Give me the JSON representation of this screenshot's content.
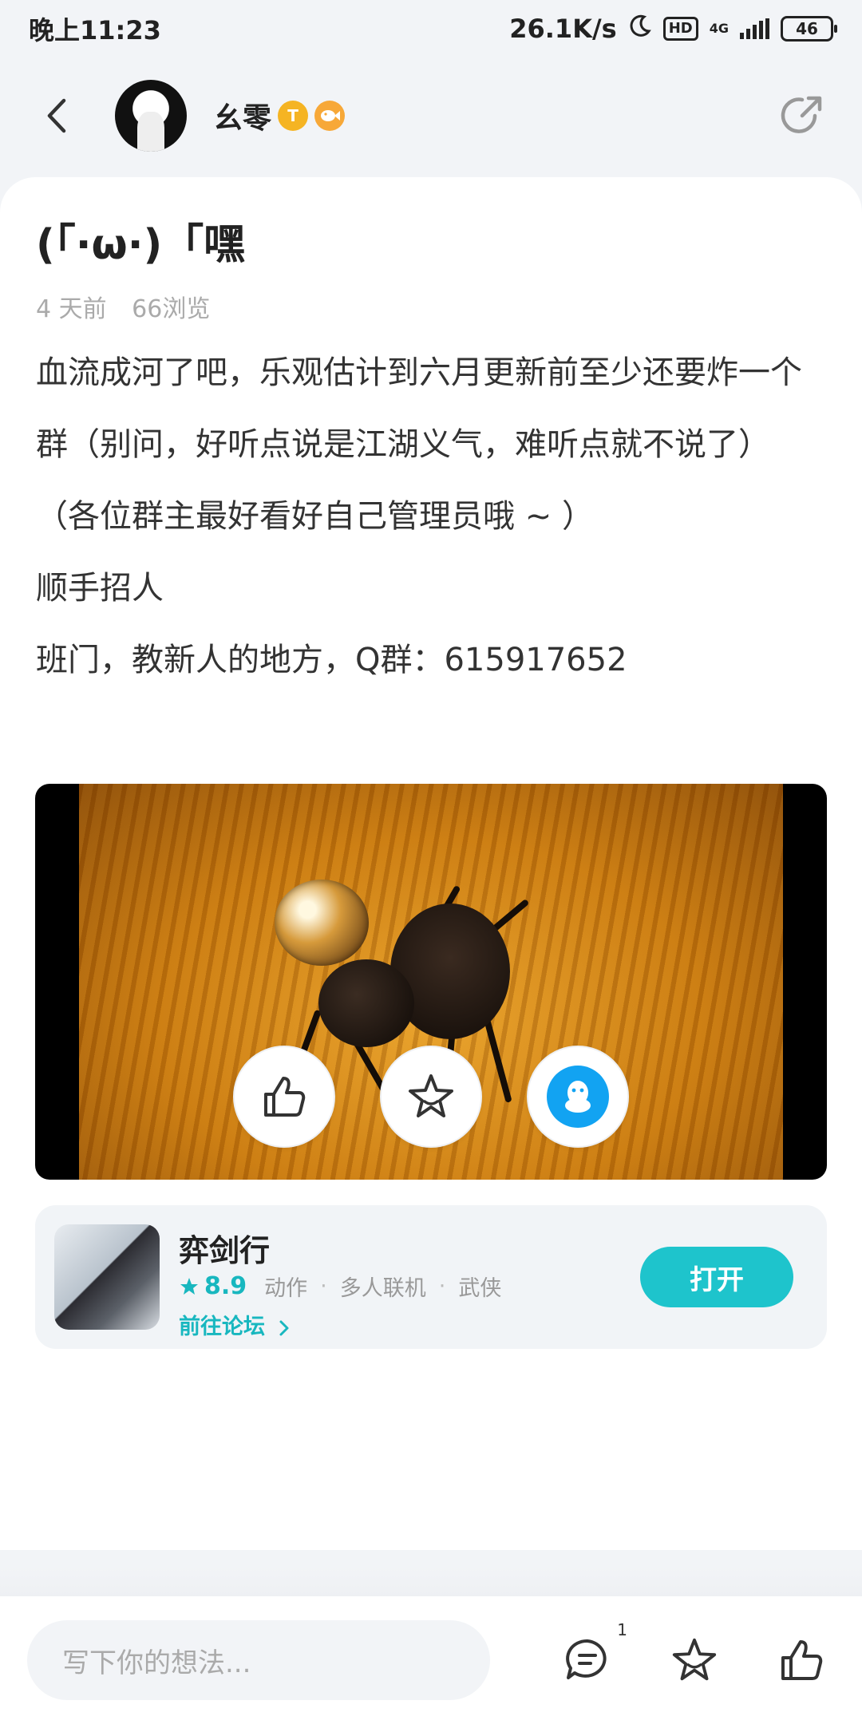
{
  "status_bar": {
    "time": "晚上11:23",
    "net_speed": "26.1K/s",
    "hd_label": "HD",
    "network_type": "4G",
    "battery": "46"
  },
  "header": {
    "author_name": "幺零",
    "badge_text": "T"
  },
  "post": {
    "title": "(「·ω·)「嘿",
    "time_ago": "4 天前",
    "views": "66浏览",
    "paragraphs": [
      "血流成河了吧，乐观估计到六月更新前至少还要炸一个群（别问，好听点说是江湖义气，难听点就不说了）",
      "（各位群主最好看好自己管理员哦 ~ ）",
      "顺手招人",
      "班门，教新人的地方，Q群：615917652"
    ]
  },
  "game": {
    "name": "弈剑行",
    "rating": "8.9",
    "tags": [
      "动作",
      "多人联机",
      "武侠"
    ],
    "forum_link": "前往论坛",
    "open_label": "打开"
  },
  "bottom": {
    "comment_placeholder": "写下你的想法...",
    "comment_count": "1"
  },
  "colors": {
    "accent": "#1ec4cc",
    "qq_blue": "#12a3f2",
    "background": "#f2f4f7"
  }
}
